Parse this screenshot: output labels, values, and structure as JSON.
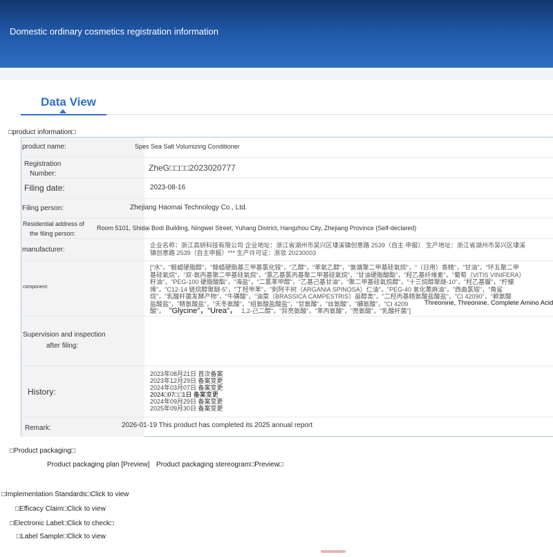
{
  "header": {
    "title": "Domestic ordinary cosmetics registration information"
  },
  "tabs": {
    "data_view": "Data View"
  },
  "sections": {
    "product_information": "□product information□",
    "product_packaging": "□Product packaging□",
    "implementation_standards": "□Implementation Standards□",
    "efficacy_claim": "□Efficacy Claim□",
    "electronic_label": "□Electronic Label□",
    "label_sample": "□Label Sample□"
  },
  "links": {
    "implementation_view": "Click to view",
    "efficacy_view": "Click to view",
    "electronic_check": "Click to check□",
    "label_view": "Click to view",
    "packaging_plan": "Product packaging plan [Preview]",
    "packaging_stereogram": "Product packaging stereogram□Preview□"
  },
  "product": {
    "name_label": "product name:",
    "name_value": "Spes Sea Salt Volumizing Conditioner",
    "reg_label_1": "Registration",
    "reg_label_2": "Number:",
    "reg_value": "ZheG□□□□2023020777",
    "filing_date_label": "Filing date:",
    "filing_date_value": "2023-08-16",
    "filing_person_label": "Filing person:",
    "filing_person_value": "Zhejiang Haomai Technology Co., Ltd.",
    "address_label_1": "Residential address of",
    "address_label_2": "the filing person:",
    "address_value": "Room 5101, Shidai Bodi Building, Ningwei Street, Yuhang District, Hangzhou City, Zhejiang Province (Self-declared)",
    "manufacturer_label": "manufacturer:",
    "manufacturer_line1": "企业名称：浙江高妍科技有限公司 企业地址：浙江省湖州市吴兴区埭溪镇创意路 2539（自主 申报） 生产地址：浙江省湖州市吴兴区埭溪",
    "manufacturer_line2": "镇创意路 2539（自主申报）*** 生产许可证：浙妆 20230003",
    "component_label": "component:",
    "component_line1": "[\"水\"，\"鲸蜡硬脂醇\"，\"鲸蜡硬脂基三甲基氯化铵\"，\"乙醇\"，\"苯氧乙醇\"，\"氨端聚二甲基硅氧烷\"，\"（日用）香精\"，\"甘油\"，\"环五聚二甲",
    "component_line2": "基硅氧烷\"，\"双-氨丙基聚二甲基硅氧烷\"，\"氯乙基氯丙基聚二甲基硅氧烷\"，\"甘油硬脂酸酯\"，\"羟乙基纤维素\"，\"葡萄（VITIS VINIFERA）",
    "component_line3": "籽油\"，\"PEG-100 硬脂酸酯\"，\"海盐\"，\"二氯苯甲醇\"，\"乙基己基甘油\"，\"聚二甲基硅氧烷醇\"，\"十三烷醇聚醚-10\"，\"羟乙基脲\"，\"柠檬",
    "component_line4": "烯\"，\"C12-14 链烷醇聚醚-5\"，\"丁羟甲苯\"，\"刺阿干树（ARGANIA SPINOSA）仁油\"，\"PEG-40 氢化蓖麻油\"，\"西曲氯铵\"，\"角鲨",
    "component_line5": "烷\"，\"乳酸杆菌发酵产物\"，\"牛磺酸\"，\"油菜（BRASSICA CAMPESTRIS）甾醇类\"，\"二羟丙基精氨酸盐酸盐\"，\"CI 42090\"，\"赖氨酸",
    "component_line6": "盐酸盐\"，\"精氨酸盐\"，\"天冬氨酸\"，\"组氨酸盐酸盐\"，\"甘氨酸\"，\"丝氨酸\"，\"脯氨酸\"，\"CI 4209",
    "component_overlay_1": "Threonine, Threonine, Complete Amino Acids",
    "component_line7a": "酸\"，",
    "component_overlay_2": "\"Glycine\"，\"Urea\"，",
    "component_line7b": "1,2-己二醇\"，\"异亮氨酸\"，\"苯丙氨酸\"，\"亮氨酸\"，\"乳酸杆菌\"]",
    "supervision_label_1": "Supervision and inspection",
    "supervision_label_2": "after filing:",
    "history_label": "History:",
    "history_1": "2023年08月21日 首次备案",
    "history_2": "2023年12月29日 备案变更",
    "history_3": "2024年03月07日 备案变更",
    "history_4": "2024□07□□1日 备案变更",
    "history_5": "2024年09月29日 备案变更",
    "history_6": "2025年09月30日 备案变更",
    "remark_label": "Remark:",
    "remark_value": "2026-01-19 This product has completed its 2025 annual report"
  },
  "colors": {
    "banner": "#1f56a5",
    "accent": "#2f6fc4",
    "label_bg": "#f3f3f3",
    "border": "#a9c6e8"
  }
}
